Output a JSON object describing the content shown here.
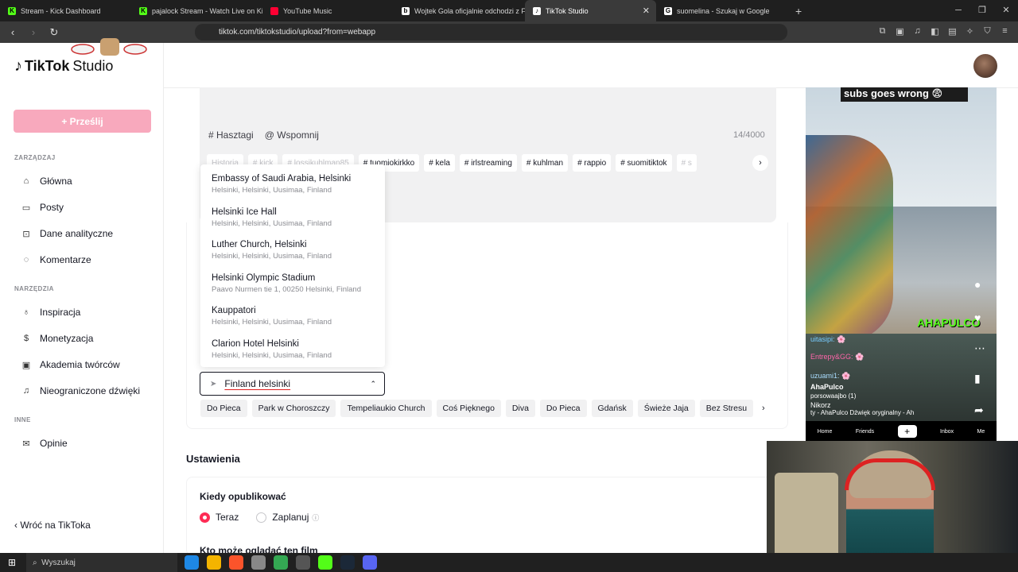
{
  "browser": {
    "tabs": [
      {
        "label": "Stream - Kick Dashboard",
        "fav": "K",
        "color": "#53fc18"
      },
      {
        "label": "pajalock Stream - Watch Live on Kick",
        "fav": "K",
        "color": "#53fc18"
      },
      {
        "label": "YouTube Music",
        "fav": "",
        "color": "#ff0033"
      },
      {
        "label": "Wojtek Gola oficjalnie odchodzi z Fa…",
        "fav": "b",
        "color": "#ffffff"
      },
      {
        "label": "TikTok Studio",
        "fav": "♪",
        "color": "#ffffff",
        "active": true
      },
      {
        "label": "suomelina - Szukaj w Google",
        "fav": "G",
        "color": "#ffffff"
      }
    ],
    "url": "tiktok.com/tiktokstudio/upload?from=webapp"
  },
  "sidebar": {
    "logo_main": "TikTok",
    "logo_sub": "Studio",
    "upload_label": "+ Prześlij",
    "section_manage": "ZARZĄDZAJ",
    "section_tools": "NARZĘDZIA",
    "section_other": "INNE",
    "items": [
      {
        "label": "Główna",
        "icon": "home-icon"
      },
      {
        "label": "Posty",
        "icon": "posts-icon"
      },
      {
        "label": "Dane analityczne",
        "icon": "analytics-icon"
      },
      {
        "label": "Komentarze",
        "icon": "comments-icon"
      },
      {
        "label": "Inspiracja",
        "icon": "bulb-icon"
      },
      {
        "label": "Monetyzacja",
        "icon": "dollar-icon"
      },
      {
        "label": "Akademia twórców",
        "icon": "academy-icon"
      },
      {
        "label": "Nieograniczone dźwięki",
        "icon": "music-icon"
      },
      {
        "label": "Opinie",
        "icon": "mail-icon"
      }
    ],
    "back_label": "Wróć na TikToka"
  },
  "editor": {
    "hashtag_label": "# Hasztagi",
    "mention_label": "@ Wspomnij",
    "counter": "14/4000",
    "chips": [
      "Historia",
      "# kick",
      "# lossikuhlman85",
      "# tuomiokirkko",
      "# kela",
      "# irlstreaming",
      "# kuhlman",
      "# rappio",
      "# suomitiktok",
      "# s"
    ]
  },
  "location": {
    "input_value": "Finland helsinki",
    "suggestions": [
      {
        "title": "Embassy of Saudi Arabia, Helsinki",
        "sub": "Helsinki, Helsinki, Uusimaa, Finland"
      },
      {
        "title": "Helsinki Ice Hall",
        "sub": "Helsinki, Helsinki, Uusimaa, Finland"
      },
      {
        "title": "Luther Church, Helsinki",
        "sub": "Helsinki, Helsinki, Uusimaa, Finland"
      },
      {
        "title": "Helsinki Olympic Stadium",
        "sub": "Paavo Nurmen tie 1, 00250 Helsinki, Finland"
      },
      {
        "title": "Kauppatori",
        "sub": "Helsinki, Helsinki, Uusimaa, Finland"
      },
      {
        "title": "Clarion Hotel Helsinki",
        "sub": "Helsinki, Helsinki, Uusimaa, Finland"
      }
    ],
    "quick_chips": [
      "Do Pieca",
      "Park w Choroszczy",
      "Tempeliaukio Church",
      "Coś Pięknego",
      "Diva",
      "Do Pieca",
      "Gdańsk",
      "Świeże Jaja",
      "Bez Stresu"
    ]
  },
  "settings": {
    "title": "Ustawienia",
    "when_label": "Kiedy opublikować",
    "now_label": "Teraz",
    "schedule_label": "Zaplanuj",
    "who_label": "Kto może oglądać ten film"
  },
  "preview": {
    "caption": "subs goes wrong 😨",
    "kick_text": "AHAPULCO",
    "chat": [
      "uitasipi: 🌸",
      "Entrepy&GG: 🌸",
      "uzuami1: 🌸",
      "AhaPulco",
      "porsowaajbo (1)",
      "Nikorz",
      "ty - AhaPulco   Dźwięk oryginalny - Ah"
    ],
    "tabs": [
      "Home",
      "Friends",
      "+",
      "Inbox",
      "Me"
    ]
  },
  "taskbar": {
    "search_label": "Wyszukaj"
  }
}
